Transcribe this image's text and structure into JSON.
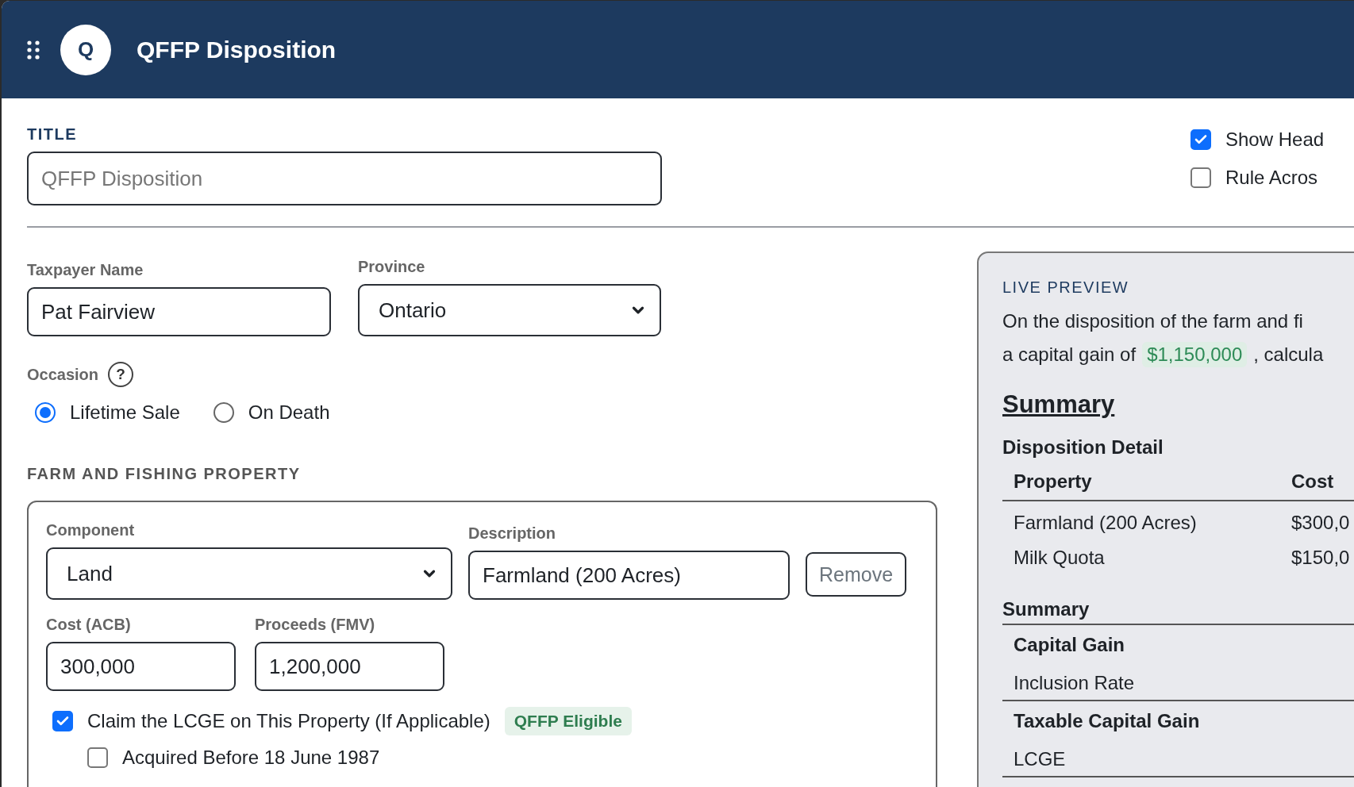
{
  "app": {
    "logo_letter": "Q",
    "title": "QFFP Disposition"
  },
  "title_field": {
    "label": "TITLE",
    "placeholder": "QFFP Disposition"
  },
  "options": [
    {
      "label": "Show Head",
      "checked": true
    },
    {
      "label": "Rule Acros",
      "checked": false
    }
  ],
  "taxpayer": {
    "label": "Taxpayer Name",
    "value": "Pat Fairview"
  },
  "province": {
    "label": "Province",
    "value": "Ontario"
  },
  "occasion": {
    "label": "Occasion",
    "help": "?",
    "choices": [
      {
        "label": "Lifetime Sale",
        "selected": true
      },
      {
        "label": "On Death",
        "selected": false
      }
    ]
  },
  "property_section": {
    "heading": "FARM AND FISHING PROPERTY",
    "component": {
      "label": "Component",
      "value": "Land"
    },
    "description": {
      "label": "Description",
      "value": "Farmland (200 Acres)"
    },
    "remove_button": "Remove",
    "cost": {
      "label": "Cost (ACB)",
      "value": "300,000"
    },
    "proceeds": {
      "label": "Proceeds (FMV)",
      "value": "1,200,000"
    },
    "claims": [
      {
        "label": "Claim the LCGE on This Property (If Applicable)",
        "checked": true,
        "badge": "QFFP Eligible"
      },
      {
        "label": "Acquired Before 18 June 1987",
        "checked": false
      }
    ]
  },
  "preview": {
    "heading": "LIVE PREVIEW",
    "line_1": "On the disposition of the farm and fi",
    "line_2_start": "a capital gain of",
    "amount": "$1,150,000",
    "line_2_end": ", calcula",
    "summary_title": "Summary",
    "detail_title": "Disposition Detail",
    "columns": [
      "Property",
      "Cost"
    ],
    "rows": [
      [
        "Farmland (200 Acres)",
        "$300,0"
      ],
      [
        "Milk Quota",
        "$150,0"
      ]
    ],
    "summary_heading": "Summary",
    "summary_rows": [
      {
        "label": "Capital Gain",
        "bold": true,
        "rule": false
      },
      {
        "label": "Inclusion Rate",
        "bold": false,
        "rule": true
      },
      {
        "label": "Taxable Capital Gain",
        "bold": true,
        "rule": false
      },
      {
        "label": "LCGE",
        "bold": false,
        "rule": true
      }
    ]
  }
}
